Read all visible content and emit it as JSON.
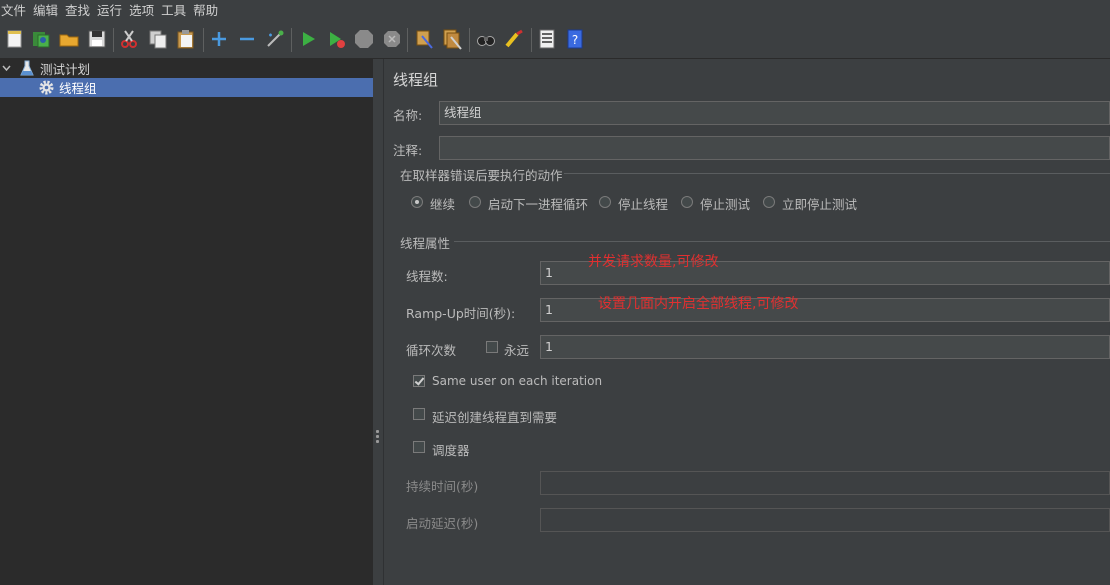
{
  "menu": [
    "文件",
    "编辑",
    "查找",
    "运行",
    "选项",
    "工具",
    "帮助"
  ],
  "tree": {
    "root_label": "测试计划",
    "child_label": "线程组"
  },
  "panel": {
    "title": "线程组",
    "name_label": "名称:",
    "name_value": "线程组",
    "comment_label": "注释:",
    "comment_value": "",
    "error_action": {
      "title": "在取样器错误后要执行的动作",
      "options": [
        "继续",
        "启动下一进程循环",
        "停止线程",
        "停止测试",
        "立即停止测试"
      ],
      "selected": "继续"
    },
    "thread_props": {
      "title": "线程属性",
      "threads_label": "线程数:",
      "threads_value": "1",
      "rampup_label": "Ramp-Up时间(秒):",
      "rampup_value": "1",
      "loop_label": "循环次数",
      "forever_label": "永远",
      "loop_value": "1",
      "same_user_label": "Same user on each iteration",
      "same_user_checked": true,
      "delay_label": "延迟创建线程直到需要",
      "delay_checked": false,
      "scheduler_label": "调度器",
      "scheduler_checked": false,
      "duration_label": "持续时间(秒)",
      "duration_value": "",
      "startup_delay_label": "启动延迟(秒)",
      "startup_delay_value": ""
    }
  },
  "annotations": {
    "threads_note": "并发请求数量,可修改",
    "rampup_note": "设置几面内开启全部线程,可修改"
  }
}
